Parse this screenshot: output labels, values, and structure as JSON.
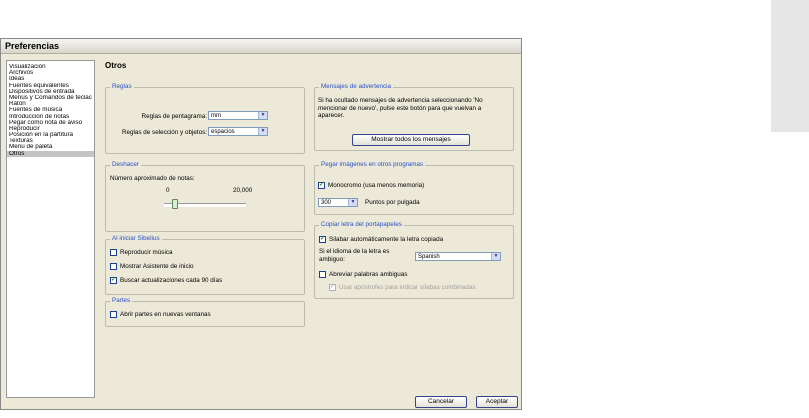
{
  "window": {
    "title": "Preferencias"
  },
  "nav": {
    "items": [
      "Visualización",
      "Archivos",
      "Ideas",
      "Fuentes equivalentes",
      "Dispositivos de entrada",
      "Menús y Comandos de teclac",
      "Ratón",
      "Fuentes de música",
      "Introducción de notas",
      "Pegar como nota de aviso",
      "Reproducir",
      "Posición en la partitura",
      "Texturas",
      "Menú de paleta",
      "Otros"
    ],
    "selected": "Otros"
  },
  "page": {
    "title": "Otros"
  },
  "reglas": {
    "legend": "Reglas",
    "staff_label": "Reglas de pentagrama:",
    "staff_value": "mm",
    "selection_label": "Reglas de selección y objetos:",
    "selection_value": "espacios"
  },
  "deshacer": {
    "legend": "Deshacer",
    "label": "Número aproximado de notas:",
    "min_label": "0",
    "max_label": "20,000",
    "slider_fraction": 0.13
  },
  "al_iniciar": {
    "legend": "Al iniciar Sibelius",
    "options": [
      {
        "label": "Reproducir música",
        "checked": false
      },
      {
        "label": "Mostrar Asistente de inicio",
        "checked": false
      },
      {
        "label": "Buscar actualizaciones cada 90 días",
        "checked": true
      }
    ]
  },
  "partes": {
    "legend": "Partes",
    "option": {
      "label": "Abrir partes en nuevas ventanas",
      "checked": false
    }
  },
  "mensajes": {
    "legend": "Mensajes de advertencia",
    "description": "Si ha ocultado mensajes de advertencia seleccionando 'No mencionar de nuevo', pulse este botón para que vuelvan a aparecer.",
    "button": "Mostrar todos los mensajes"
  },
  "pegar": {
    "legend": "Pegar imágenes en otros programas",
    "mono_label": "Monocromo (usa menos memoria)",
    "mono_checked": true,
    "dpi_value": "300",
    "dpi_label": "Puntos por pulgada"
  },
  "copiar": {
    "legend": "Copiar letra del portapapeles",
    "auto_label": "Silabar automáticamente la letra copiada",
    "auto_checked": true,
    "lang_label": "Si el idioma de la letra es ambiguo:",
    "lang_value": "Spanish",
    "abbr_label": "Abreviar palabras ambiguas",
    "abbr_checked": false,
    "apos_label": "Usar apóstrofes para indicar sílabas combinadas",
    "apos_checked": true
  },
  "footer": {
    "cancel": "Cancelar",
    "accept": "Aceptar"
  },
  "icons": {
    "dropdown": "chevron-down-icon",
    "check": "check-icon"
  }
}
